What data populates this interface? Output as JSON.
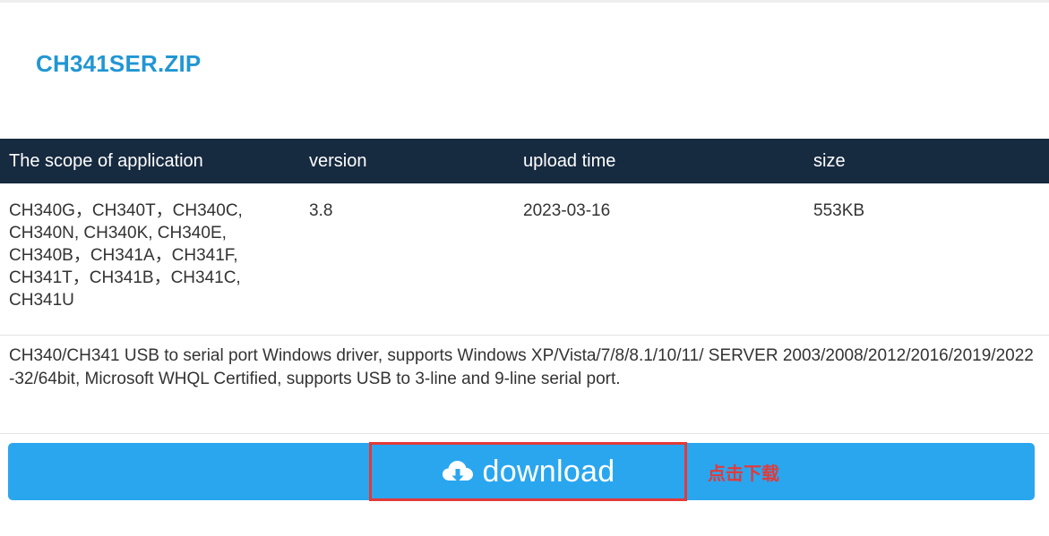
{
  "file": {
    "name": "CH341SER.ZIP"
  },
  "table": {
    "headers": {
      "scope": "The scope of application",
      "version": "version",
      "upload_time": "upload time",
      "size": "size"
    },
    "row": {
      "scope_lines": [
        "CH340G，CH340T，CH340C,",
        "CH340N, CH340K, CH340E,",
        "CH340B，CH341A，CH341F,",
        "CH341T，CH341B，CH341C,",
        "CH341U"
      ],
      "version": "3.8",
      "upload_time": "2023-03-16",
      "size": "553KB"
    }
  },
  "description": "CH340/CH341 USB to serial port Windows driver, supports Windows XP/Vista/7/8/8.1/10/11/ SERVER 2003/2008/2012/2016/2019/2022 -32/64bit, Microsoft WHQL Certified, supports USB to 3-line and 9-line serial port.",
  "download": {
    "icon": "cloud-download-icon",
    "label": "download",
    "annotation": "点击下载",
    "bar_color": "#2aa6ef",
    "highlight_color": "#e23a3a"
  },
  "colors": {
    "title": "#2196d3",
    "header_bg": "#162a40"
  }
}
